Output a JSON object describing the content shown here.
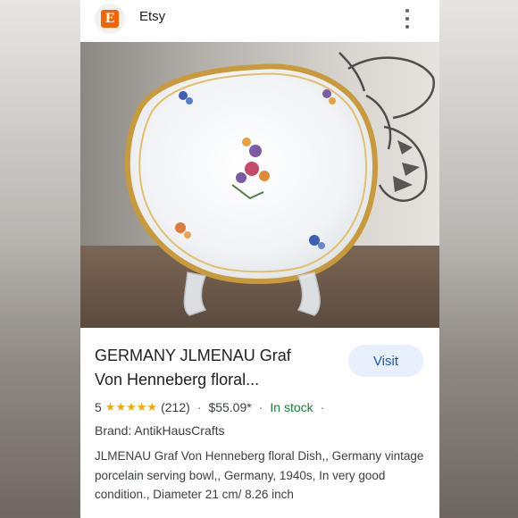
{
  "site": {
    "name": "Etsy",
    "logo_letter": "E",
    "icon": "etsy-logo-icon",
    "more_icon": "kebab-menu-icon"
  },
  "product": {
    "title": "GERMANY JLMENAU Graf Von Henneberg floral...",
    "visit_label": "Visit",
    "rating": "5",
    "stars": "★★★★★",
    "review_count": "(212)",
    "price": "$55.09*",
    "stock": "In stock",
    "brand": "Brand: AntikHausCrafts",
    "description": "JLMENAU Graf Von Henneberg floral Dish,, Germany vintage porcelain serving bowl,, Germany, 1940s, In very good condition., Diameter 21 cm/ 8.26 inch"
  },
  "colors": {
    "accent": "#f56400",
    "visit_bg": "#e8f0fe",
    "visit_text": "#1a56c2",
    "stock": "#188038",
    "stars": "#f2a900"
  }
}
